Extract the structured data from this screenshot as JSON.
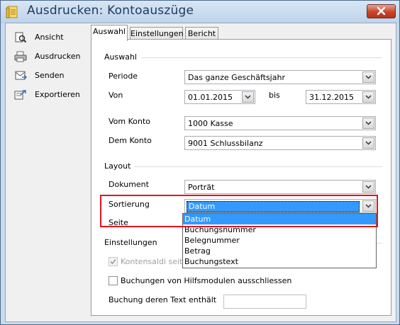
{
  "window": {
    "title": "Ausdrucken: Kontoauszüge"
  },
  "sidebar": {
    "items": [
      {
        "label": "Ansicht",
        "icon": "preview-icon"
      },
      {
        "label": "Ausdrucken",
        "icon": "printer-icon"
      },
      {
        "label": "Senden",
        "icon": "send-icon"
      },
      {
        "label": "Exportieren",
        "icon": "export-icon"
      }
    ]
  },
  "tabs": [
    {
      "label": "Auswahl",
      "active": true
    },
    {
      "label": "Einstellungen",
      "active": false
    },
    {
      "label": "Bericht",
      "active": false
    }
  ],
  "groups": {
    "auswahl": "Auswahl",
    "layout": "Layout",
    "einstellungen": "Einstellungen"
  },
  "fields": {
    "periode": {
      "label": "Periode",
      "value": "Das ganze Geschäftsjahr"
    },
    "von": {
      "label": "Von",
      "value": "01.01.2015"
    },
    "bis": {
      "label": "bis",
      "value": "31.12.2015"
    },
    "vom_konto": {
      "label": "Vom Konto",
      "value": "1000 Kasse"
    },
    "dem_konto": {
      "label": "Dem Konto",
      "value": "9001 Schlussbilanz"
    },
    "dokument": {
      "label": "Dokument",
      "value": "Porträt"
    },
    "sortierung": {
      "label": "Sortierung",
      "value": "Datum",
      "options": [
        "Datum",
        "Buchungsnummer",
        "Belegnummer",
        "Betrag",
        "Buchungstext"
      ],
      "selected_option": "Datum"
    },
    "seite": {
      "label": "Seite"
    }
  },
  "settings": {
    "kontensaldi": {
      "label": "Kontensaldi seit Beg",
      "checked": true,
      "enabled": false
    },
    "hilfsmodule": {
      "label": "Buchungen von Hilfsmodulen ausschliessen",
      "checked": false
    },
    "buchung_text": {
      "label": "Buchung deren Text enthält",
      "value": ""
    }
  },
  "colors": {
    "highlight": "#e0141f",
    "selection": "#3399ff",
    "title_text": "#1e395b",
    "close_button": "#c7432b"
  }
}
